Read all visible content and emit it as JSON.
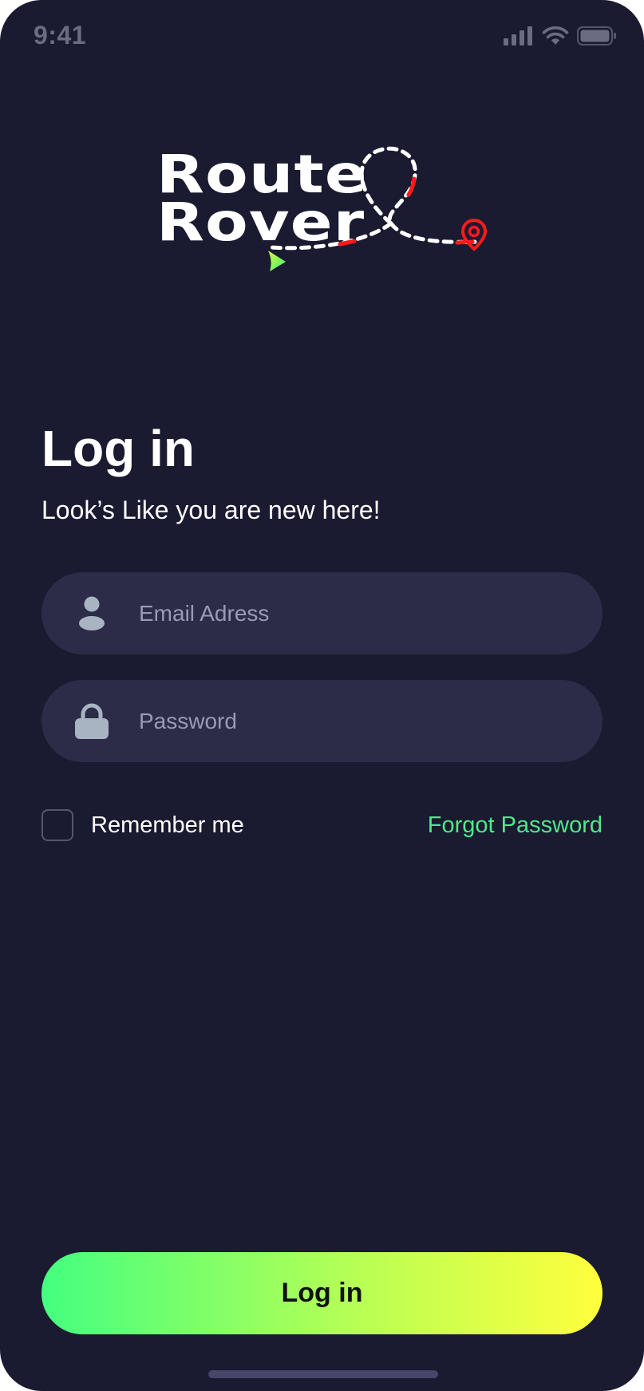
{
  "status_bar": {
    "time": "9:41"
  },
  "logo": {
    "line1": "Route",
    "line2": "Rover"
  },
  "page": {
    "title": "Log in",
    "subtitle": "Look’s Like you are new here!"
  },
  "form": {
    "email": {
      "placeholder": "Email Adress",
      "value": "",
      "icon": "user-icon"
    },
    "password": {
      "placeholder": "Password",
      "value": "",
      "icon": "lock-icon"
    },
    "remember_me": {
      "label": "Remember me",
      "checked": false
    },
    "forgot_password_label": "Forgot Password",
    "submit_label": "Log in"
  },
  "colors": {
    "background": "#1a1a31",
    "field": "#2c2c48",
    "accent_green": "#4fe88a",
    "button_gradient_start": "#44ff80",
    "button_gradient_end": "#ffff3c",
    "route_red": "#ff1a1a"
  }
}
